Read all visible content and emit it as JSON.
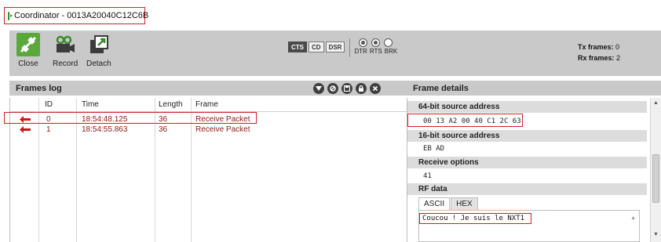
{
  "window": {
    "title": "Coordinator - 0013A20040C12C6B"
  },
  "toolbar": {
    "close_label": "Close",
    "record_label": "Record",
    "detach_label": "Detach",
    "status_pills": [
      "CTS",
      "CD",
      "DSR"
    ],
    "pill_states": [
      true,
      false,
      false
    ],
    "led_labels": [
      "DTR",
      "RTS",
      "BRK"
    ],
    "led_states": [
      true,
      true,
      false
    ],
    "tx_label": "Tx frames:",
    "tx_value": "0",
    "rx_label": "Rx frames:",
    "rx_value": "2"
  },
  "frames_log": {
    "title": "Frames log",
    "header_icons": [
      "filter-icon",
      "clear-icon",
      "save-icon",
      "lock-icon",
      "close-icon"
    ],
    "columns": [
      "ID",
      "Time",
      "Length",
      "Frame"
    ],
    "rows": [
      {
        "id": "0",
        "time": "18:54:48.125",
        "length": "36",
        "frame": "Receive Packet",
        "direction_icon": "arrow-left-icon"
      },
      {
        "id": "1",
        "time": "18:54:55.863",
        "length": "36",
        "frame": "Receive Packet",
        "direction_icon": "arrow-left-icon"
      }
    ]
  },
  "frame_details": {
    "title": "Frame details",
    "sections": [
      {
        "label": "64-bit source address",
        "value": "00 13 A2 00 40 C1 2C 63"
      },
      {
        "label": "16-bit source address",
        "value": "EB AD"
      },
      {
        "label": "Receive options",
        "value": "41"
      },
      {
        "label": "RF data",
        "value": ""
      }
    ],
    "rf_tabs": [
      "ASCII",
      "HEX"
    ],
    "rf_ascii": "Coucou ! Je suis le NXT1"
  },
  "colors": {
    "toolbar_bg": "#c9c9c9",
    "close_button_green": "#58a93a",
    "highlight_red": "#d32020",
    "row_text": "#8b1a1a"
  }
}
